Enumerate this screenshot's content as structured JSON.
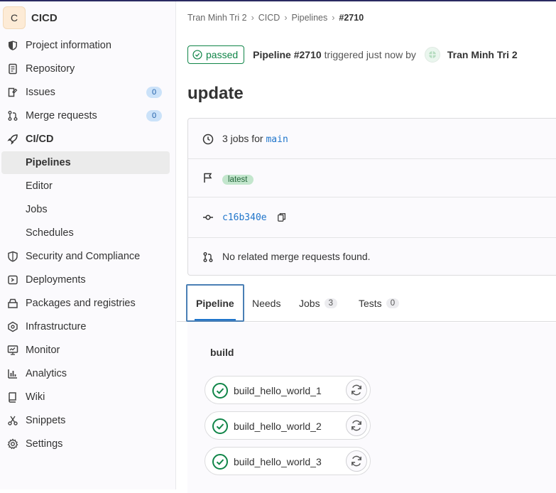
{
  "project": {
    "avatar_letter": "C",
    "name": "CICD"
  },
  "sidebar": {
    "project_information": "Project information",
    "repository": "Repository",
    "issues": "Issues",
    "issues_count": "0",
    "merge_requests": "Merge requests",
    "merge_requests_count": "0",
    "cicd": "CI/CD",
    "pipelines": "Pipelines",
    "editor": "Editor",
    "jobs": "Jobs",
    "schedules": "Schedules",
    "security": "Security and Compliance",
    "deployments": "Deployments",
    "packages": "Packages and registries",
    "infrastructure": "Infrastructure",
    "monitor": "Monitor",
    "analytics": "Analytics",
    "wiki": "Wiki",
    "snippets": "Snippets",
    "settings": "Settings"
  },
  "breadcrumb": [
    "Tran Minh Tri 2",
    "CICD",
    "Pipelines",
    "#2710"
  ],
  "pipeline": {
    "status": "passed",
    "title": "Pipeline #2710",
    "triggered": "triggered just now by",
    "user": "Tran Minh Tri 2",
    "commit_title": "update"
  },
  "info": {
    "jobs_prefix": "3 jobs for",
    "branch": "main",
    "tag": "latest",
    "sha": "c16b340e",
    "mr_text": "No related merge requests found."
  },
  "tabs": {
    "pipeline": "Pipeline",
    "needs": "Needs",
    "jobs": "Jobs",
    "jobs_count": "3",
    "tests": "Tests",
    "tests_count": "0"
  },
  "stage": {
    "name": "build",
    "jobs": [
      "build_hello_world_1",
      "build_hello_world_2",
      "build_hello_world_3"
    ]
  },
  "colors": {
    "success": "#108548",
    "link": "#1f75cb",
    "badge_bg": "#cbe2f9"
  }
}
